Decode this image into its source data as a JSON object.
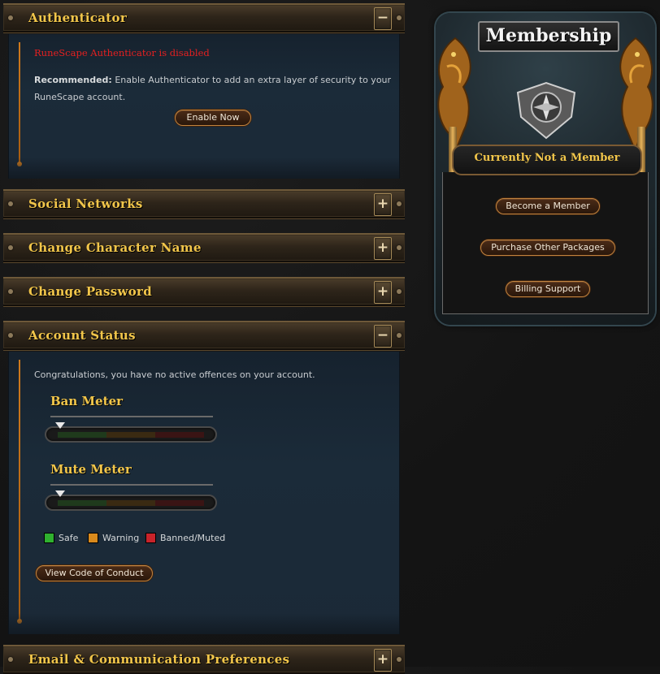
{
  "panels": {
    "authenticator": {
      "title": "Authenticator",
      "toggle": "−",
      "warning": "RuneScape Authenticator is disabled",
      "recommended_label": "Recommended:",
      "recommended_text": "Enable Authenticator to add an extra layer of security to your",
      "recommended_text_2": "RuneScape account.",
      "button": "Enable Now"
    },
    "social": {
      "title": "Social Networks",
      "toggle": "+"
    },
    "character_name": {
      "title": "Change Character Name",
      "toggle": "+"
    },
    "password": {
      "title": "Change Password",
      "toggle": "+"
    },
    "account_status": {
      "title": "Account Status",
      "toggle": "−",
      "message": "Congratulations, you have no active offences on your account.",
      "ban_meter": {
        "title": "Ban Meter",
        "level": 0
      },
      "mute_meter": {
        "title": "Mute Meter",
        "level": 0
      },
      "legend": [
        {
          "label": "Safe",
          "color": "#2fb12f"
        },
        {
          "label": "Warning",
          "color": "#d98a1c"
        },
        {
          "label": "Banned/Muted",
          "color": "#c8232a"
        }
      ],
      "button": "View Code of Conduct"
    },
    "email": {
      "title": "Email & Communication Preferences",
      "toggle": "+"
    }
  },
  "membership": {
    "title": "Membership",
    "status": "Currently Not a Member",
    "buttons": [
      "Become a Member",
      "Purchase Other Packages",
      "Billing Support"
    ]
  },
  "colors": {
    "accent_gold": "#f2c64a",
    "warning_red": "#e52020",
    "button_border": "#c2843f",
    "panel_blue": "#1b2b39"
  }
}
